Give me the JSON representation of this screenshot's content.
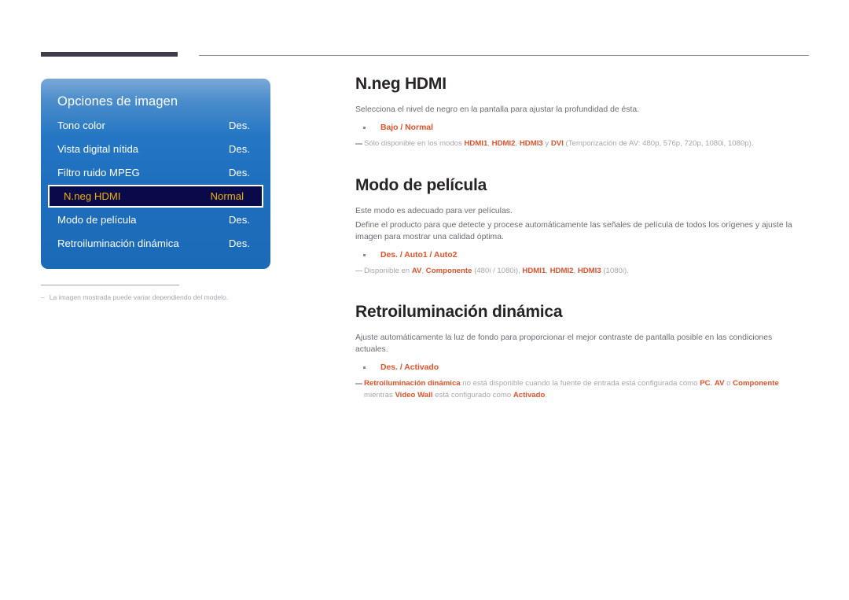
{
  "colors": {
    "accent_orange": "#e2522b",
    "panel_blue_top": "#7aa9d8",
    "panel_blue_bottom": "#1b6ab6",
    "selected_row_bg": "#0a0a4a",
    "selected_row_text": "#ecb100",
    "heading": "#272425",
    "body_text": "#6e6b72",
    "note_text": "#a8a5ad",
    "top_rule_thick": "#403c4a"
  },
  "osd": {
    "title": "Opciones de imagen",
    "rows": [
      {
        "label": "Tono color",
        "value": "Des.",
        "selected": false
      },
      {
        "label": "Vista digital nítida",
        "value": "Des.",
        "selected": false
      },
      {
        "label": "Filtro ruido MPEG",
        "value": "Des.",
        "selected": false
      },
      {
        "label": "N.neg HDMI",
        "value": "Normal",
        "selected": true
      },
      {
        "label": "Modo de película",
        "value": "Des.",
        "selected": false
      },
      {
        "label": "Retroiluminación dinámica",
        "value": "Des.",
        "selected": false
      }
    ],
    "footnote_dash": "–",
    "footnote": "La imagen mostrada puede variar dependiendo del modelo."
  },
  "sections": [
    {
      "id": "n-neg-hdmi",
      "heading": "N.neg HDMI",
      "paragraphs": [
        "Selecciona el nivel de negro en la pantalla para ajustar la profundidad de ésta."
      ],
      "bullet": "Bajo / Normal",
      "note_html": "Sólo disponible en los modos <b>HDMI1</b>, <b>HDMI2</b>, <b>HDMI3</b> y <b>DVI</b> (Temporización de AV: 480p, 576p, 720p, 1080i, 1080p)."
    },
    {
      "id": "modo-de-pelicula",
      "heading": "Modo de película",
      "paragraphs": [
        "Este modo es adecuado para ver películas.",
        "Define el producto para que detecte y procese automáticamente las señales de película de todos los orígenes y ajuste la imagen para mostrar una calidad óptima."
      ],
      "bullet": "Des. / Auto1 / Auto2",
      "note_html": "Disponible en <b>AV</b>, <b>Componente</b> (480i / 1080i), <b>HDMI1</b>, <b>HDMI2</b>, <b>HDMI3</b> (1080i)."
    },
    {
      "id": "retroiluminacion-dinamica",
      "heading": "Retroiluminación dinámica",
      "paragraphs": [
        "Ajuste automáticamente la luz de fondo para proporcionar el mejor contraste de pantalla posible en las condiciones actuales."
      ],
      "bullet": "Des. / Activado",
      "note_html": "<b>Retroiluminación dinámica</b> no está disponible cuando la fuente de entrada está configurada como <b>PC</b>, <b>AV</b> o <b>Componente</b> mientras <b>Video Wall</b> está configurado como <b>Activado</b>."
    }
  ]
}
